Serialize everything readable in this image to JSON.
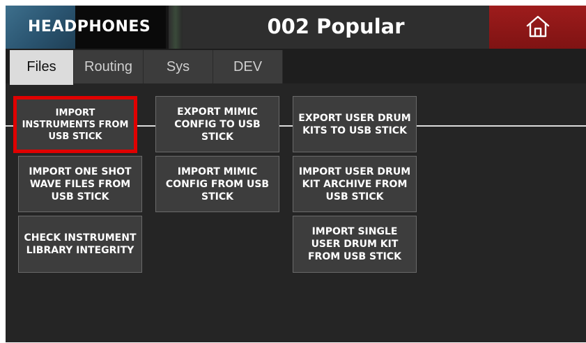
{
  "header": {
    "logo_text": "HEADPHONES",
    "title": "002 Popular",
    "home_icon": "home-icon"
  },
  "tabs": [
    {
      "label": "Files",
      "active": true
    },
    {
      "label": "Routing",
      "active": false
    },
    {
      "label": "Sys",
      "active": false
    },
    {
      "label": "DEV",
      "active": false
    }
  ],
  "buttons": {
    "import_instruments": "IMPORT INSTRUMENTS FROM USB STICK",
    "export_mimic": "EXPORT MIMIC CONFIG TO USB STICK",
    "export_drum_kits": "EXPORT USER DRUM KITS TO USB STICK",
    "import_one_shot": "IMPORT ONE SHOT WAVE FILES FROM USB STICK",
    "import_mimic": "IMPORT MIMIC CONFIG FROM USB STICK",
    "import_drum_archive": "IMPORT USER DRUM KIT ARCHIVE FROM USB STICK",
    "check_library": "CHECK INSTRUMENT LIBRARY INTEGRITY",
    "import_single_kit": "IMPORT SINGLE USER DRUM KIT FROM USB STICK"
  },
  "colors": {
    "home_bg": "#8b1717",
    "selection_outline": "#e00000",
    "logo_blue": "#2f5f7c"
  }
}
